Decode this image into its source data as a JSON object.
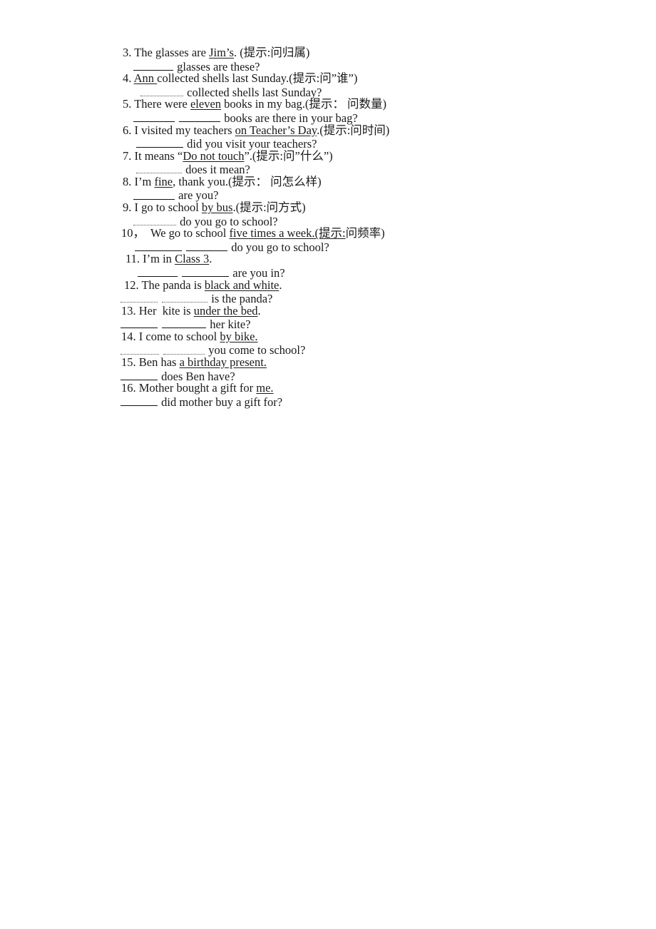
{
  "document": {
    "type": "english-grammar-worksheet",
    "language_note": "English sentences with Chinese parenthetical hints",
    "page_background": "#ffffff",
    "text_color": "#1a1a1a"
  },
  "items": [
    {
      "number": "3.",
      "prompt_before": " The glasses are ",
      "underlined": "Jim’s",
      "prompt_after": ". (提示:问归属)",
      "answer_blanks": 1,
      "answer_text": " glasses are these?"
    },
    {
      "number": "4.",
      "prompt_before": " ",
      "underlined": "Ann ",
      "prompt_after": "collected shells last Sunday.(提示:问”谁”)",
      "answer_blanks": 1,
      "answer_text": " collected shells last Sunday?"
    },
    {
      "number": "5.",
      "prompt_before": " There were ",
      "underlined": "eleven",
      "prompt_after": " books in my bag.(提示： 问数量)",
      "answer_blanks": 2,
      "answer_text": " books are there in your bag?"
    },
    {
      "number": "6.",
      "prompt_before": " I visited my teachers ",
      "underlined": "on Teacher’s Day",
      "prompt_after": ".(提示:问时间)",
      "answer_blanks": 1,
      "answer_text": " did you visit your teachers?"
    },
    {
      "number": "7.",
      "prompt_before": " It means “",
      "underlined": "Do not touch",
      "prompt_after": "”.(提示:问”什么”)",
      "answer_blanks": 1,
      "answer_text": " does it mean?"
    },
    {
      "number": "8.",
      "prompt_before": " I’m ",
      "underlined": "fine",
      "prompt_after": ", thank you.(提示： 问怎么样)",
      "answer_blanks": 1,
      "answer_text": " are you?"
    },
    {
      "number": "9.",
      "prompt_before": " I go to school ",
      "underlined": "by bus",
      "prompt_after": ".(提示:问方式)",
      "answer_blanks": 1,
      "answer_text": " do you go to school?"
    },
    {
      "number": "10，",
      "prompt_before": "  We go to school ",
      "underlined": "five times a week.(提示:",
      "prompt_after": "问频率)",
      "answer_blanks": 2,
      "answer_text": " do you go to school?"
    },
    {
      "number": "11.",
      "prompt_before": " I’m in ",
      "underlined": "Class 3",
      "prompt_after": ".",
      "answer_blanks": 2,
      "answer_text": " are you in?"
    },
    {
      "number": "12.",
      "prompt_before": " The panda is ",
      "underlined": "black and white",
      "prompt_after": ".",
      "answer_blanks": 2,
      "answer_text": " is the panda?"
    },
    {
      "number": "13.",
      "prompt_before": " Her  kite is ",
      "underlined": "under the bed",
      "prompt_after": ".",
      "answer_blanks": 2,
      "answer_text": " her kite?"
    },
    {
      "number": "14.",
      "prompt_before": " I come to school ",
      "underlined": "by bike.",
      "prompt_after": "",
      "answer_blanks": 2,
      "answer_text": " you come to school?"
    },
    {
      "number": "15.",
      "prompt_before": " Ben has ",
      "underlined": "a birthday present.",
      "prompt_after": "",
      "answer_blanks": 1,
      "answer_text": " does Ben have?"
    },
    {
      "number": "16.",
      "prompt_before": " Mother bought a gift for ",
      "underlined": "me.",
      "prompt_after": "",
      "answer_blanks": 1,
      "answer_text": " did mother buy a gift for?"
    }
  ],
  "layout": {
    "rows": [
      {
        "kind": "q",
        "item": 0,
        "indent": 4,
        "group": "tight"
      },
      {
        "kind": "a",
        "item": 0,
        "indent": 18,
        "group": "tight",
        "blank_widths": [
          56
        ],
        "blank_style": [
          "solid"
        ]
      },
      {
        "kind": "q",
        "item": 1,
        "indent": 4,
        "group": "tight"
      },
      {
        "kind": "a",
        "item": 1,
        "indent": 28,
        "group": "tight",
        "blank_widths": [
          60
        ],
        "blank_style": [
          "soft"
        ]
      },
      {
        "kind": "q",
        "item": 2,
        "indent": 4,
        "group": "tight"
      },
      {
        "kind": "a",
        "item": 2,
        "indent": 18,
        "group": "tight",
        "blank_widths": [
          58,
          58
        ],
        "blank_style": [
          "solid",
          "solid"
        ]
      },
      {
        "kind": "q",
        "item": 3,
        "indent": 4,
        "group": "tight"
      },
      {
        "kind": "a",
        "item": 3,
        "indent": 22,
        "group": "tight",
        "blank_widths": [
          66
        ],
        "blank_style": [
          "solid"
        ]
      },
      {
        "kind": "q",
        "item": 4,
        "indent": 4,
        "group": "tight"
      },
      {
        "kind": "a",
        "item": 4,
        "indent": 22,
        "group": "tight",
        "blank_widths": [
          64
        ],
        "blank_style": [
          "soft"
        ]
      },
      {
        "kind": "q",
        "item": 5,
        "indent": 4,
        "group": "tight"
      },
      {
        "kind": "a",
        "item": 5,
        "indent": 18,
        "group": "tight",
        "blank_widths": [
          58
        ],
        "blank_style": [
          "solid"
        ]
      },
      {
        "kind": "q",
        "item": 6,
        "indent": 4,
        "group": "tight"
      },
      {
        "kind": "a",
        "item": 6,
        "indent": 18,
        "group": "tight",
        "blank_widths": [
          60
        ],
        "blank_style": [
          "soft"
        ]
      },
      {
        "kind": "q",
        "item": 7,
        "indent": 2,
        "group": "tight"
      },
      {
        "kind": "a",
        "item": 7,
        "indent": 20,
        "group": "loose",
        "blank_widths": [
          66,
          58
        ],
        "blank_style": [
          "solid",
          "solid"
        ]
      },
      {
        "kind": "q",
        "item": 8,
        "indent": 8,
        "group": "loose"
      },
      {
        "kind": "a",
        "item": 8,
        "indent": 24,
        "group": "loose",
        "blank_widths": [
          56,
          66
        ],
        "blank_style": [
          "solid",
          "solid"
        ]
      },
      {
        "kind": "q",
        "item": 9,
        "indent": 6,
        "group": "loose"
      },
      {
        "kind": "a",
        "item": 9,
        "indent": 0,
        "group": "loose",
        "blank_widths": [
          52,
          64
        ],
        "blank_style": [
          "soft",
          "soft"
        ]
      },
      {
        "kind": "q",
        "item": 10,
        "indent": 2,
        "group": "loose"
      },
      {
        "kind": "a",
        "item": 10,
        "indent": 0,
        "group": "loose",
        "blank_widths": [
          52,
          62
        ],
        "blank_style": [
          "solid",
          "solid"
        ]
      },
      {
        "kind": "q",
        "item": 11,
        "indent": 2,
        "group": "loose"
      },
      {
        "kind": "a",
        "item": 11,
        "indent": 0,
        "group": "loose",
        "blank_widths": [
          54,
          58
        ],
        "blank_style": [
          "soft",
          "soft"
        ]
      },
      {
        "kind": "q",
        "item": 12,
        "indent": 2,
        "group": "loose"
      },
      {
        "kind": "a",
        "item": 12,
        "indent": 0,
        "group": "loose",
        "blank_widths": [
          52
        ],
        "blank_style": [
          "solid"
        ]
      },
      {
        "kind": "q",
        "item": 13,
        "indent": 2,
        "group": "loose"
      },
      {
        "kind": "a",
        "item": 13,
        "indent": 0,
        "group": "loose",
        "blank_widths": [
          52
        ],
        "blank_style": [
          "solid"
        ]
      }
    ]
  }
}
